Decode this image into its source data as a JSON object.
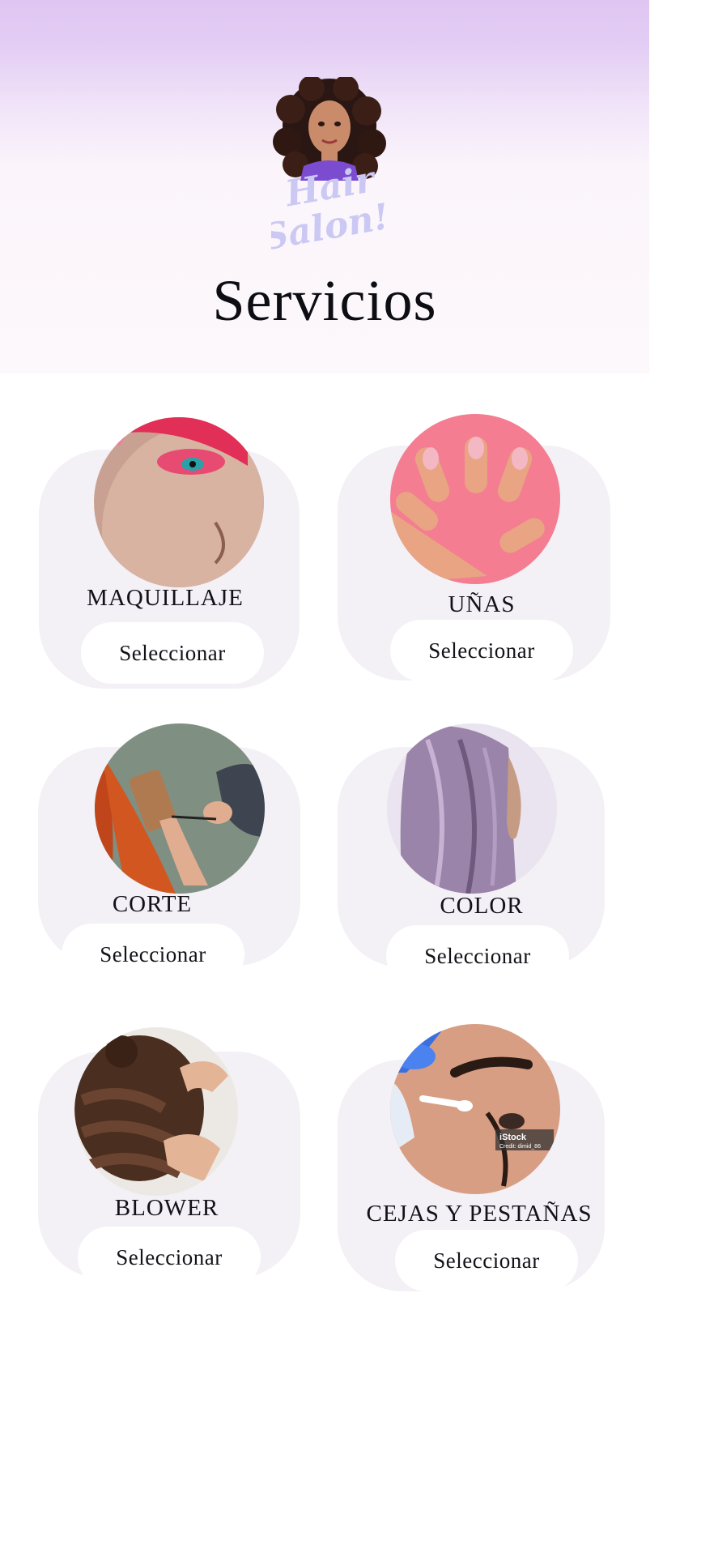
{
  "header": {
    "title": "Servicios",
    "logo_text": "Hair Salon!"
  },
  "services": [
    {
      "label": "MAQUILLAJE",
      "button": "Seleccionar"
    },
    {
      "label": "UÑAS",
      "button": "Seleccionar"
    },
    {
      "label": "CORTE",
      "button": "Seleccionar"
    },
    {
      "label": "COLOR",
      "button": "Seleccionar"
    },
    {
      "label": "BLOWER",
      "button": "Seleccionar"
    },
    {
      "label": "CEJAS Y PESTAÑAS",
      "button": "Seleccionar"
    }
  ],
  "photo_watermark": {
    "brand": "iStock",
    "credit": "Credit: dimid_86"
  },
  "colors": {
    "header_top": "#dfc6f2",
    "card_bg": "#f3f0f6",
    "button_bg": "#ffffff",
    "text": "#121218"
  }
}
